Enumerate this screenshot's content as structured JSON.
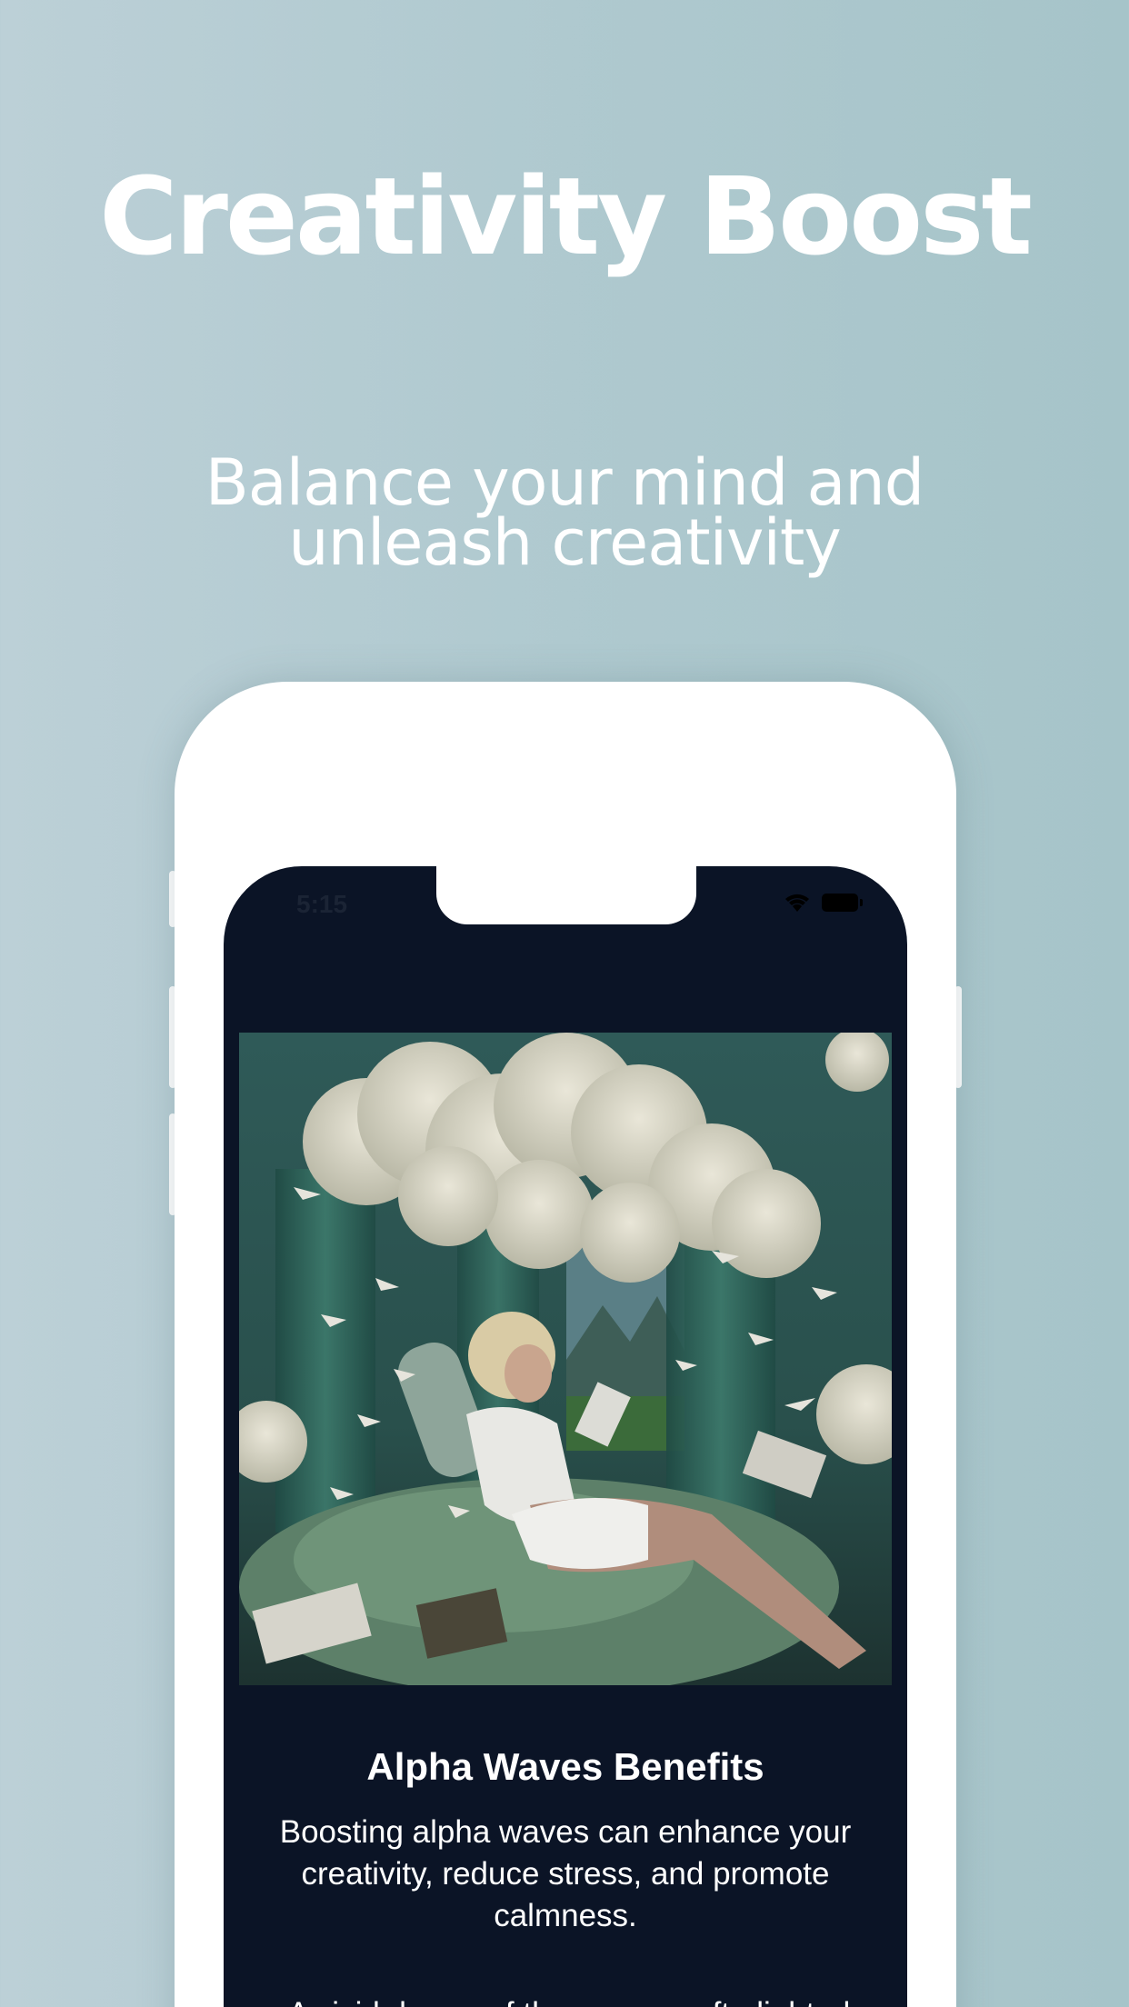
{
  "promo": {
    "headline": "Creativity Boost",
    "subline_line1": "Balance your mind and",
    "subline_line2": "unleash creativity"
  },
  "status_bar": {
    "time": "5:15",
    "icons": [
      "wifi-icon",
      "battery-icon"
    ]
  },
  "hero_image": {
    "description_icon": "illustration-woman-reading-under-clouds"
  },
  "card": {
    "title": "Alpha Waves Benefits",
    "body": "Boosting alpha waves can enhance your creativity, reduce stress, and promote calmness.",
    "body_partial": "A vivid dream of the scene, soft...lighted"
  },
  "colors": {
    "background": "#aec8ce",
    "screen": "#0b1426",
    "text": "#ffffff"
  }
}
